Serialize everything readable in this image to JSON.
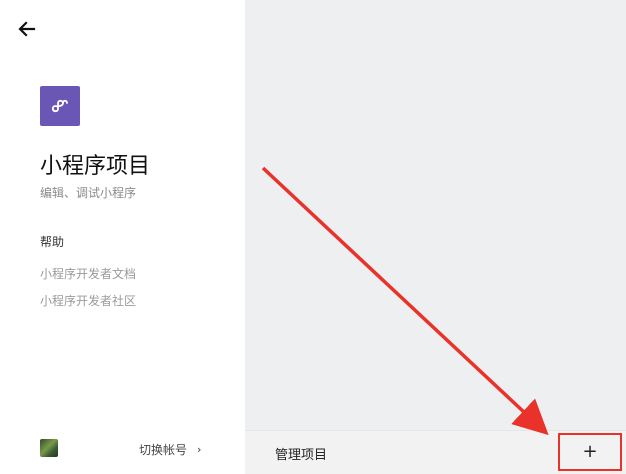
{
  "sidebar": {
    "back_icon": "arrow-left-icon",
    "app": {
      "icon": "mini-program-icon",
      "icon_color": "#6a56b4",
      "title": "小程序项目",
      "subtitle": "编辑、调试小程序"
    },
    "help": {
      "heading": "帮助",
      "links": [
        {
          "label": "小程序开发者文档"
        },
        {
          "label": "小程序开发者社区"
        }
      ]
    },
    "account": {
      "switch_label": "切换帐号",
      "chevron": "›"
    }
  },
  "main": {
    "background": "#eeeff1",
    "bottom_bar": {
      "manage_label": "管理项目",
      "add_label": "+"
    }
  },
  "annotation": {
    "arrow_color": "#e8322a"
  }
}
